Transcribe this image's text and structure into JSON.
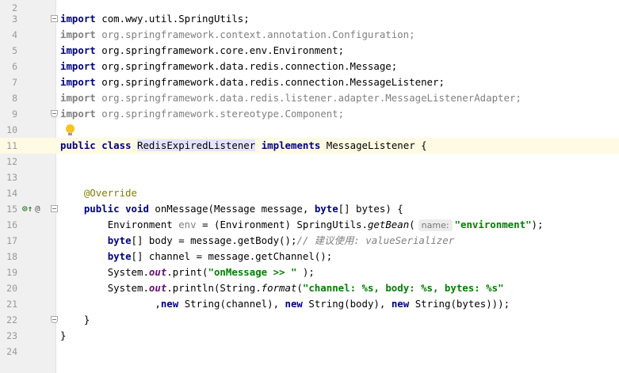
{
  "editor": {
    "current_line": 11,
    "lines": [
      {
        "n": "2"
      },
      {
        "n": "3"
      },
      {
        "n": "4"
      },
      {
        "n": "5"
      },
      {
        "n": "6"
      },
      {
        "n": "7"
      },
      {
        "n": "8"
      },
      {
        "n": "9"
      },
      {
        "n": "10"
      },
      {
        "n": "11"
      },
      {
        "n": "12"
      },
      {
        "n": "13"
      },
      {
        "n": "14"
      },
      {
        "n": "15"
      },
      {
        "n": "16"
      },
      {
        "n": "17"
      },
      {
        "n": "18"
      },
      {
        "n": "19"
      },
      {
        "n": "20"
      },
      {
        "n": "21"
      },
      {
        "n": "22"
      },
      {
        "n": "23"
      },
      {
        "n": "24"
      }
    ],
    "tokens": {
      "import": "import",
      "imp1": "com.wwy.util.SpringUtils;",
      "imp2": "org.springframework.context.annotation.Configuration;",
      "imp3": "org.springframework.core.env.Environment;",
      "imp4": "org.springframework.data.redis.connection.Message;",
      "imp5": "org.springframework.data.redis.connection.MessageListener;",
      "imp6": "org.springframework.data.redis.listener.adapter.MessageListenerAdapter;",
      "imp7": "org.springframework.stereotype.Component;",
      "public": "public",
      "class": "class",
      "class_name": "RedisExpiredListener",
      "implements": "implements",
      "iface": "MessageListener {",
      "override": "@Override",
      "void": "void",
      "method_sig_a": "onMessage(Message message,",
      "byte": "byte",
      "method_sig_b": "[] bytes) {",
      "l16_a": "Environment",
      "l16_var": "env",
      "l16_b": "= (Environment) SpringUtils.",
      "l16_call": "getBean",
      "l16_c": "(",
      "l16_hint": "name:",
      "l16_str": "\"environment\"",
      "l16_d": ");",
      "l17_a": "[] body = message.getBody();",
      "l17_cmt": "// 建议使用: valueSerializer",
      "l18_a": "[] channel = message.getChannel();",
      "sys": "System.",
      "out": "out",
      "l19_a": ".print(",
      "l19_str": "\"onMessage >> \"",
      "l19_b": " );",
      "l20_a": ".println(String.",
      "l20_fmt": "format",
      "l20_b": "(",
      "l20_str": "\"channel: %s, body: %s, bytes: %s\"",
      "l21_a": ",",
      "new": "new",
      "l21_b": "String(channel),",
      "l21_c": "String(body),",
      "l21_d": "String(bytes)));",
      "close_brace": "}",
      "gutter_implements": "⊙↑",
      "gutter_override": "@"
    }
  }
}
